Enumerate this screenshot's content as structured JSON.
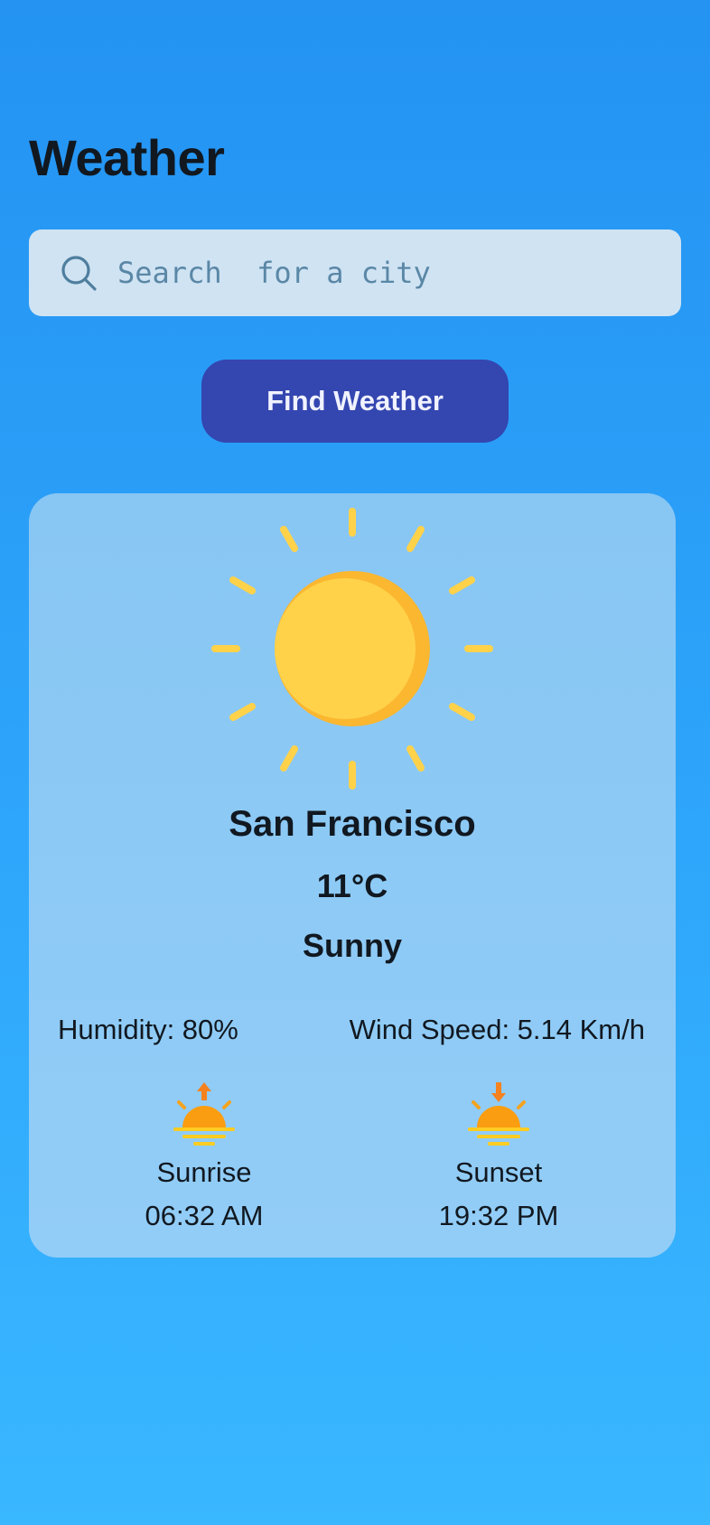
{
  "header": {
    "title": "Weather"
  },
  "search": {
    "placeholder": "Search  for a city",
    "value": ""
  },
  "actions": {
    "find_label": "Find Weather"
  },
  "weather": {
    "city": "San Francisco",
    "temperature": "11°C",
    "condition": "Sunny",
    "icon": "sun-icon",
    "humidity": "Humidity: 80%",
    "wind": "Wind Speed: 5.14 Km/h"
  },
  "sunrise": {
    "label": "Sunrise",
    "time": "06:32 AM",
    "icon": "sunrise-icon"
  },
  "sunset": {
    "label": "Sunset",
    "time": "19:32 PM",
    "icon": "sunset-icon"
  },
  "colors": {
    "background": "#2493f2",
    "button": "#3446b0",
    "card": "#8cc8f3",
    "sun": "#ffd24a",
    "sun_shade": "#fbb730"
  }
}
